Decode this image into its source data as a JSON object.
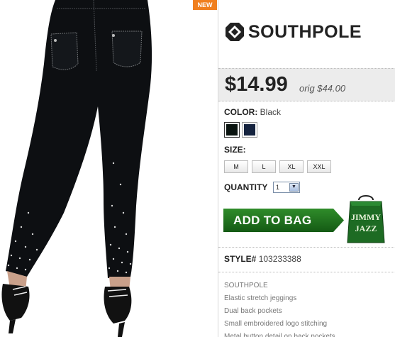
{
  "badge": {
    "new": "NEW"
  },
  "brand": {
    "name": "SOUTHPOLE"
  },
  "price": {
    "current": "$14.99",
    "original": "orig $44.00"
  },
  "color": {
    "label": "COLOR:",
    "selected": "Black",
    "swatches": [
      "#0a1410",
      "#15233f"
    ]
  },
  "size": {
    "label": "SIZE:",
    "options": [
      "M",
      "L",
      "XL",
      "XXL"
    ]
  },
  "quantity": {
    "label": "QUANTITY",
    "value": "1"
  },
  "cart": {
    "add_label": "ADD TO BAG",
    "logo_text_1": "JIMMY",
    "logo_text_2": "JAZZ"
  },
  "style": {
    "label": "STYLE#",
    "number": "103233388"
  },
  "description": [
    "SOUTHPOLE",
    "Elastic stretch jeggings",
    "Dual back pockets",
    "Small embroidered logo stitching",
    "Metal button detail on back pockets"
  ]
}
